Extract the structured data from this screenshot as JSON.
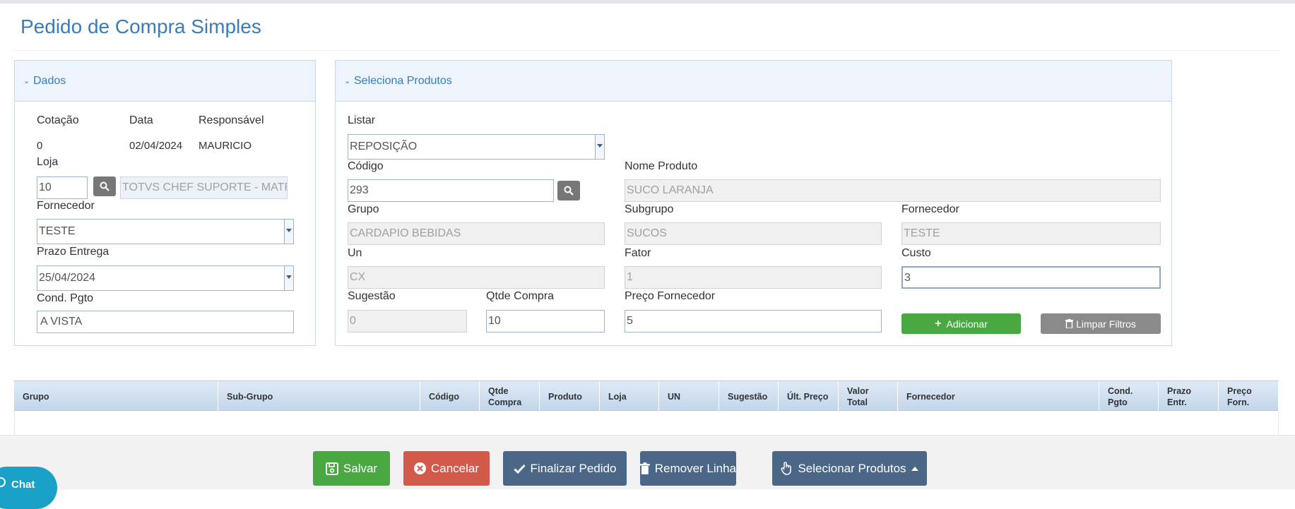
{
  "page": {
    "title": "Pedido de Compra Simples"
  },
  "dados": {
    "title": "Dados",
    "cotacao_label": "Cotação",
    "data_label": "Data",
    "responsavel_label": "Responsável",
    "cotacao_value": "0",
    "data_value": "02/04/2024",
    "responsavel_value": "MAURICIO",
    "loja_label": "Loja",
    "loja_value": "10",
    "loja_nome": "TOTVS CHEF SUPORTE - MATRIZ",
    "fornecedor_label": "Fornecedor",
    "fornecedor_value": "TESTE",
    "prazo_label": "Prazo Entrega",
    "prazo_value": "25/04/2024",
    "cond_label": "Cond. Pgto",
    "cond_value": "A VISTA"
  },
  "produtos": {
    "title": "Seleciona Produtos",
    "listar_label": "Listar",
    "listar_value": "REPOSIÇÃO",
    "codigo_label": "Código",
    "codigo_value": "293",
    "nome_label": "Nome Produto",
    "nome_value": "SUCO LARANJA",
    "grupo_label": "Grupo",
    "grupo_value": "CARDAPIO BEBIDAS",
    "subgrupo_label": "Subgrupo",
    "subgrupo_value": "SUCOS",
    "fornecedor_label": "Fornecedor",
    "fornecedor_value": "TESTE",
    "un_label": "Un",
    "un_value": "CX",
    "fator_label": "Fator",
    "fator_value": "1",
    "custo_label": "Custo",
    "custo_value": "3",
    "sugestao_label": "Sugestão",
    "sugestao_value": "0",
    "qtde_label": "Qtde Compra",
    "qtde_value": "10",
    "preco_label": "Preço Fornecedor",
    "preco_value": "5",
    "adicionar_label": "Adicionar",
    "limpar_label": "Limpar Filtros"
  },
  "grid": {
    "columns": [
      {
        "label": "Grupo"
      },
      {
        "label": "Sub-Grupo"
      },
      {
        "label": "Código"
      },
      {
        "label": "Qtde Compra"
      },
      {
        "label": "Produto"
      },
      {
        "label": "Loja"
      },
      {
        "label": "UN"
      },
      {
        "label": "Sugestão"
      },
      {
        "label": "Últ. Preço"
      },
      {
        "label": "Valor Total"
      },
      {
        "label": "Fornecedor"
      },
      {
        "label": "Cond. Pgto"
      },
      {
        "label": "Prazo Entr."
      },
      {
        "label": "Preço Forn."
      }
    ]
  },
  "footer": {
    "salvar": "Salvar",
    "cancelar": "Cancelar",
    "finalizar": "Finalizar Pedido",
    "remover": "Remover Linha",
    "selecionar": "Selecionar Produtos"
  },
  "chat": {
    "label": "Chat"
  },
  "colors": {
    "accent": "#3a7cba",
    "success": "#4aa843",
    "danger": "#d35a4b",
    "navy": "#4a6787",
    "chat": "#1aa1c8"
  }
}
